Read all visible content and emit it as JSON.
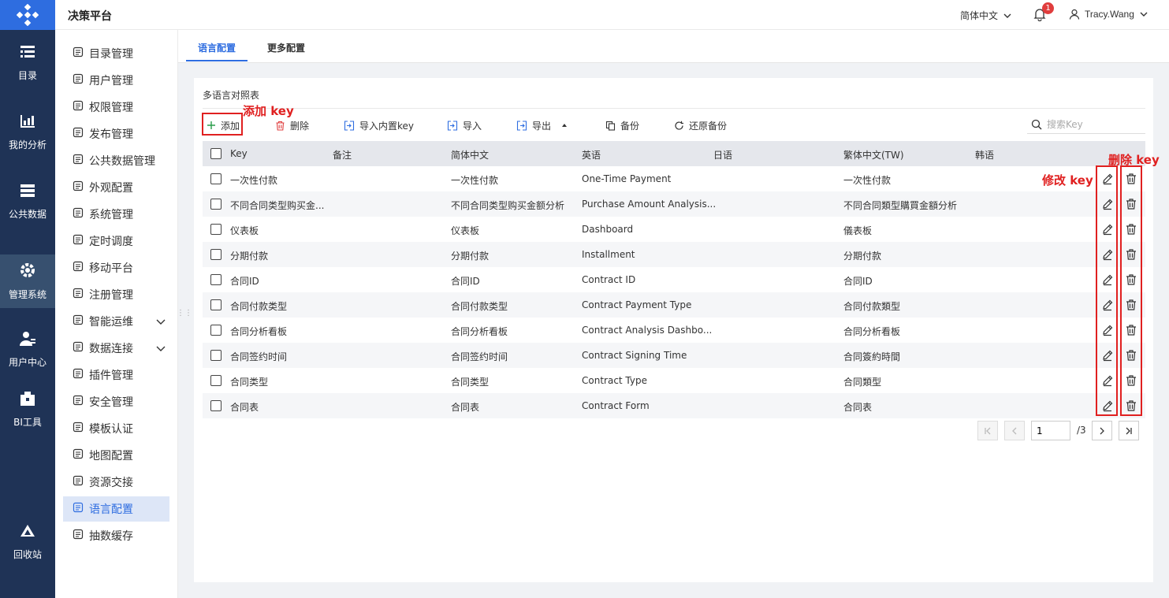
{
  "rail": {
    "items": [
      {
        "label": "目录",
        "icon": "catalog-icon"
      },
      {
        "label": "我的分析",
        "icon": "analysis-chart-icon"
      },
      {
        "label": "公共数据",
        "icon": "database-icon"
      },
      {
        "label": "管理系统",
        "icon": "gear-icon"
      },
      {
        "label": "用户中心",
        "icon": "user-center-icon"
      },
      {
        "label": "BI工具",
        "icon": "toolbox-icon"
      },
      {
        "label": "回收站",
        "icon": "recycle-icon"
      }
    ],
    "active_index": 3
  },
  "header": {
    "title": "决策平台",
    "language": "简体中文",
    "notification_count": "1",
    "username": "Tracy.Wang"
  },
  "sidebar": {
    "items": [
      {
        "label": "目录管理"
      },
      {
        "label": "用户管理"
      },
      {
        "label": "权限管理"
      },
      {
        "label": "发布管理"
      },
      {
        "label": "公共数据管理"
      },
      {
        "label": "外观配置"
      },
      {
        "label": "系统管理"
      },
      {
        "label": "定时调度"
      },
      {
        "label": "移动平台"
      },
      {
        "label": "注册管理"
      },
      {
        "label": "智能运维"
      },
      {
        "label": "数据连接"
      },
      {
        "label": "插件管理"
      },
      {
        "label": "安全管理"
      },
      {
        "label": "模板认证"
      },
      {
        "label": "地图配置"
      },
      {
        "label": "资源交接"
      },
      {
        "label": "语言配置"
      },
      {
        "label": "抽数缓存"
      }
    ],
    "active_index": 17,
    "expandable": [
      "智能运维",
      "数据连接"
    ]
  },
  "tabs": [
    {
      "label": "语言配置",
      "active": true
    },
    {
      "label": "更多配置",
      "active": false
    }
  ],
  "panel": {
    "title": "多语言对照表",
    "toolbar": {
      "add": "添加",
      "delete": "删除",
      "import_builtin": "导入内置key",
      "import": "导入",
      "export": "导出",
      "backup": "备份",
      "restore": "还原备份"
    },
    "search_placeholder": "搜索Key"
  },
  "table": {
    "columns": [
      "Key",
      "备注",
      "简体中文",
      "英语",
      "日语",
      "繁体中文(TW)",
      "韩语"
    ],
    "rows": [
      [
        "一次性付款",
        "",
        "一次性付款",
        "One-Time Payment",
        "",
        "一次性付款",
        ""
      ],
      [
        "不同合同类型购买金...",
        "",
        "不同合同类型购买金额分析",
        "Purchase Amount Analysis...",
        "",
        "不同合同類型購買金額分析",
        ""
      ],
      [
        "仪表板",
        "",
        "仪表板",
        "Dashboard",
        "",
        "儀表板",
        ""
      ],
      [
        "分期付款",
        "",
        "分期付款",
        "Installment",
        "",
        "分期付款",
        ""
      ],
      [
        "合同ID",
        "",
        "合同ID",
        "Contract ID",
        "",
        "合同ID",
        ""
      ],
      [
        "合同付款类型",
        "",
        "合同付款类型",
        "Contract Payment Type",
        "",
        "合同付款類型",
        ""
      ],
      [
        "合同分析看板",
        "",
        "合同分析看板",
        "Contract Analysis Dashbo...",
        "",
        "合同分析看板",
        ""
      ],
      [
        "合同签约时间",
        "",
        "合同签约时间",
        "Contract Signing Time",
        "",
        "合同簽約時間",
        ""
      ],
      [
        "合同类型",
        "",
        "合同类型",
        "Contract Type",
        "",
        "合同類型",
        ""
      ],
      [
        "合同表",
        "",
        "合同表",
        "Contract Form",
        "",
        "合同表",
        ""
      ]
    ]
  },
  "pagination": {
    "current": "1",
    "total": "/3"
  },
  "annotations": {
    "add_key": "添加 key",
    "edit_key": "修改 key",
    "delete_key": "删除 key",
    "color": "#e02020"
  },
  "colors": {
    "rail_bg": "#1f3356",
    "accent": "#2e6de0",
    "add_green": "#2a9d4b",
    "delete_red": "#e04040"
  }
}
